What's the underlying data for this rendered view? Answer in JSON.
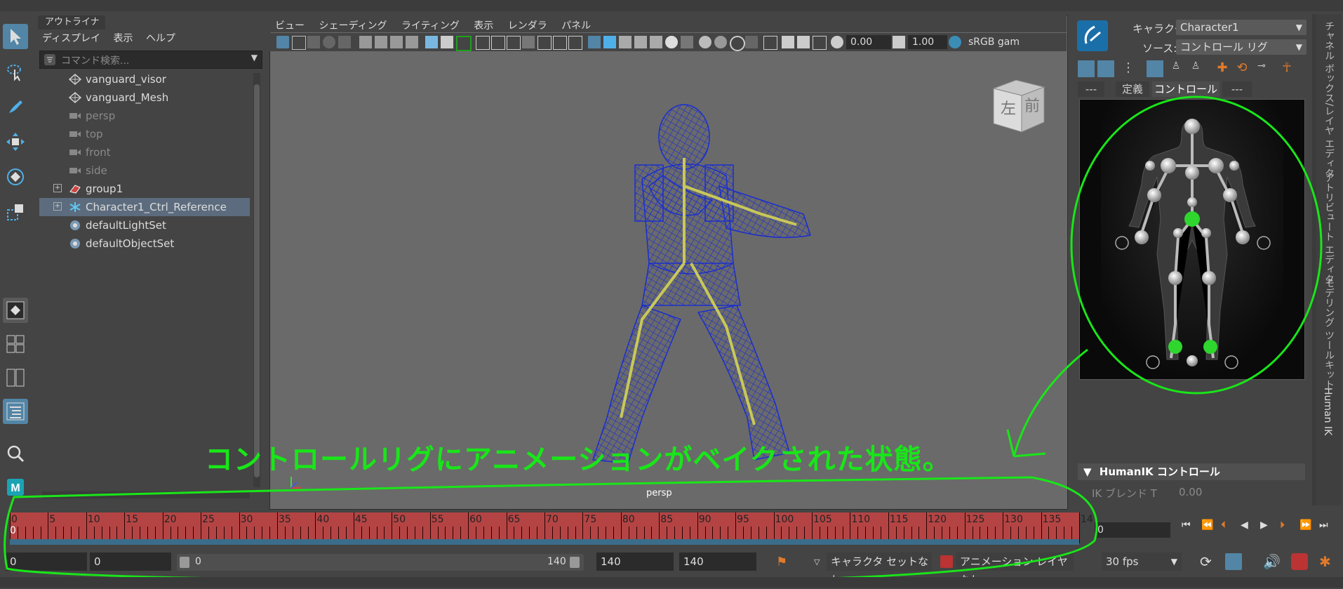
{
  "outliner": {
    "tab_label": "アウトライナ",
    "menu": [
      "ディスプレイ",
      "表示",
      "ヘルプ"
    ],
    "search_placeholder": "コマンド検索...",
    "items": [
      {
        "label": "vanguard_visor",
        "icon": "mesh-icon",
        "dim": false
      },
      {
        "label": "vanguard_Mesh",
        "icon": "mesh-icon",
        "dim": false
      },
      {
        "label": "persp",
        "icon": "camera-icon",
        "dim": true
      },
      {
        "label": "top",
        "icon": "camera-icon",
        "dim": true
      },
      {
        "label": "front",
        "icon": "camera-icon",
        "dim": true
      },
      {
        "label": "side",
        "icon": "camera-icon",
        "dim": true
      },
      {
        "label": "group1",
        "icon": "group-icon",
        "dim": false
      },
      {
        "label": "Character1_Ctrl_Reference",
        "icon": "hik-reference-icon",
        "dim": false,
        "selected": true
      },
      {
        "label": "defaultLightSet",
        "icon": "set-icon",
        "dim": false
      },
      {
        "label": "defaultObjectSet",
        "icon": "set-icon",
        "dim": false
      }
    ]
  },
  "viewport": {
    "menu": [
      "ビュー",
      "シェーディング",
      "ライティング",
      "表示",
      "レンダラ",
      "パネル"
    ],
    "exposure_value": "0.00",
    "gamma_value": "1.00",
    "color_space": "sRGB gam",
    "camera_label": "persp",
    "viewcube_left": "左",
    "viewcube_front": "前"
  },
  "humanik": {
    "character_label": "キャラクタ:",
    "character_value": "Character1",
    "source_label": "ソース:",
    "source_value": "コントロール リグ",
    "tabs": [
      "---",
      "定義",
      "コントロール",
      "---"
    ],
    "active_tab": "コントロール",
    "section_title": "HumanIK コントロール",
    "ik_blend_label": "IK ブレンド T",
    "ik_blend_value": "0.00"
  },
  "side_tabs": [
    "チャネル ボックス/レイヤ エディタ",
    "アトリビュート エディタ",
    "モデリング ツールキット",
    "Human IK"
  ],
  "timeline": {
    "labels": [
      "0",
      "5",
      "10",
      "15",
      "20",
      "25",
      "30",
      "35",
      "40",
      "45",
      "50",
      "55",
      "60",
      "65",
      "70",
      "75",
      "80",
      "85",
      "90",
      "95",
      "100",
      "105",
      "110",
      "115",
      "120",
      "125",
      "130",
      "135",
      "14"
    ],
    "current_frame_marker": "0",
    "current_frame_field": "0"
  },
  "range": {
    "start_field": "0",
    "anim_start_field": "0",
    "slider_start": "0",
    "slider_end": "140",
    "anim_end_field": "140",
    "end_field": "140",
    "character_set": "キャラクタ セットなし",
    "anim_layer": "アニメーション レイヤなし",
    "fps": "30 fps"
  },
  "annotation": {
    "text": "コントロールリグにアニメーションがベイクされた状態。",
    "color": "#19e619"
  },
  "colors": {
    "mesh_wire": "#1a2ecf",
    "selection_blue": "#5285a6",
    "timeline_red": "#b44444",
    "hik_green": "#2ed62e"
  }
}
